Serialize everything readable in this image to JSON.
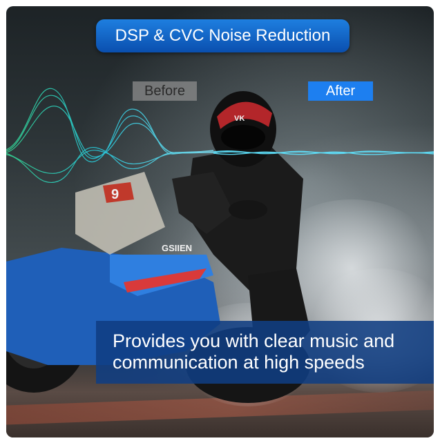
{
  "title": "DSP & CVC Noise Reduction",
  "labels": {
    "before": "Before",
    "after": "After"
  },
  "caption": {
    "line1": "Provides you with clear music and",
    "line2": "communication at high speeds"
  },
  "helmet_mark": "VK",
  "bike_number": "9",
  "bike_brand": "GSIIEN",
  "colors": {
    "accent_blue": "#1d7ff0",
    "title_blue_dark": "#0a4fae",
    "caption_bg": "#103e82",
    "wave_cyan": "#27d3e8",
    "wave_green": "#34e39a",
    "before_tag_bg": "#8c8c8c"
  }
}
